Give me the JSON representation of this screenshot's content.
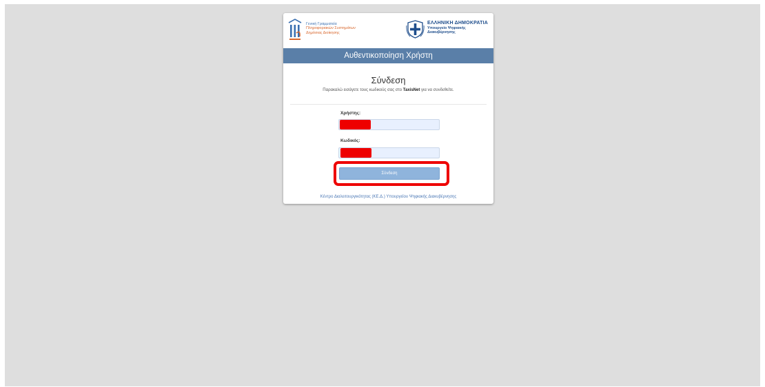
{
  "logos": {
    "gsis_line1": "Γενική Γραμματεία",
    "gsis_line2": "Πληροφοριακών Συστημάτων",
    "gsis_line3": "Δημόσιας Διοίκησης",
    "gr_line1": "ΕΛΛΗΝΙΚΗ ΔΗΜΟΚΡΑΤΙΑ",
    "gr_line2": "Υπουργείο Ψηφιακής",
    "gr_line3": "Διακυβέρνησης"
  },
  "header": {
    "title": "Αυθεντικοποίηση Χρήστη"
  },
  "login": {
    "title": "Σύνδεση",
    "subtitle_before": "Παρακαλώ εισάγετε τους κωδικούς σας στο ",
    "subtitle_brand": "TaxisNet",
    "subtitle_after": " για να συνδεθείτε.",
    "username_label": "Χρήστης:",
    "password_label": "Κωδικός:",
    "submit_label": "Σύνδεση"
  },
  "footer": {
    "link_text": "Κέντρο Διαλειτουργικότητας (ΚΕ.Δ.) Υπουργείου Ψηφιακής Διακυβέρνησης"
  },
  "colors": {
    "page_background": "#dedede",
    "header_bar": "#5a7fa8",
    "button": "#8fb4dc",
    "input_background": "#e8f0fe",
    "redaction": "#ee0000",
    "highlight": "#ee0000",
    "link": "#4a77b4"
  },
  "icons": {
    "gsis": "gsis-logo-icon",
    "republic": "greek-emblem-icon"
  }
}
